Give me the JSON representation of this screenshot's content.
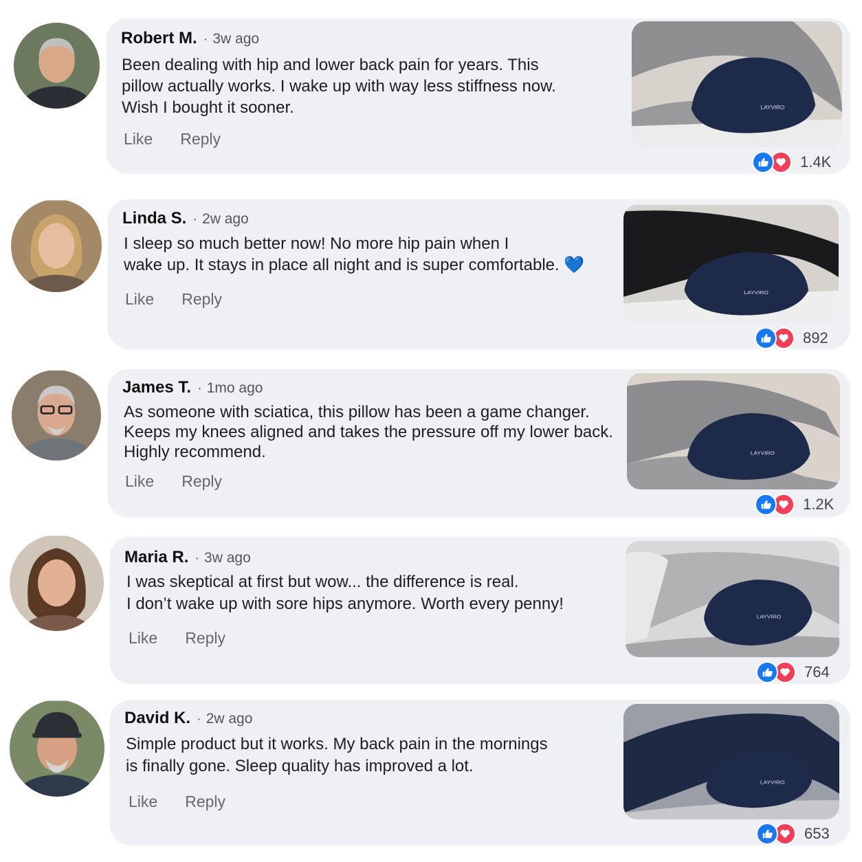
{
  "colors": {
    "like": "#1877f2",
    "love": "#f33e58",
    "bubble": "#eef0f4",
    "pillow": "#1d2a4a"
  },
  "labels": {
    "like": "Like",
    "reply": "Reply"
  },
  "comments": [
    {
      "name": "Robert M.",
      "time": "3w ago",
      "lines": [
        "Been dealing with hip and lower back pain for years. This",
        "pillow actually works. I wake up with way less stiffness now.",
        "Wish I bought it sooner."
      ],
      "reactions": "1.4K",
      "brand": "LAYVIRO"
    },
    {
      "name": "Linda S.",
      "time": "2w ago",
      "lines": [
        "I sleep so much better now! No more hip pain when I",
        "wake up. It stays in place all night and is super comfortable. 💙"
      ],
      "reactions": "892",
      "brand": "LAYVIRO"
    },
    {
      "name": "James T.",
      "time": "1mo ago",
      "lines": [
        "As someone with sciatica, this pillow has been a game changer.",
        "Keeps my knees aligned and takes the pressure off my lower back.",
        "Highly recommend."
      ],
      "reactions": "1.2K",
      "brand": "LAYVIRO"
    },
    {
      "name": "Maria R.",
      "time": "3w ago",
      "lines": [
        "I was skeptical at first but wow... the difference is real.",
        "I don’t wake up with sore hips anymore. Worth every penny!"
      ],
      "reactions": "764",
      "brand": "LAYVIRO"
    },
    {
      "name": "David K.",
      "time": "2w ago",
      "lines": [
        "Simple product but it works. My back pain in the mornings",
        "is finally gone. Sleep quality has improved a lot."
      ],
      "reactions": "653",
      "brand": "LAYVIRO"
    }
  ]
}
